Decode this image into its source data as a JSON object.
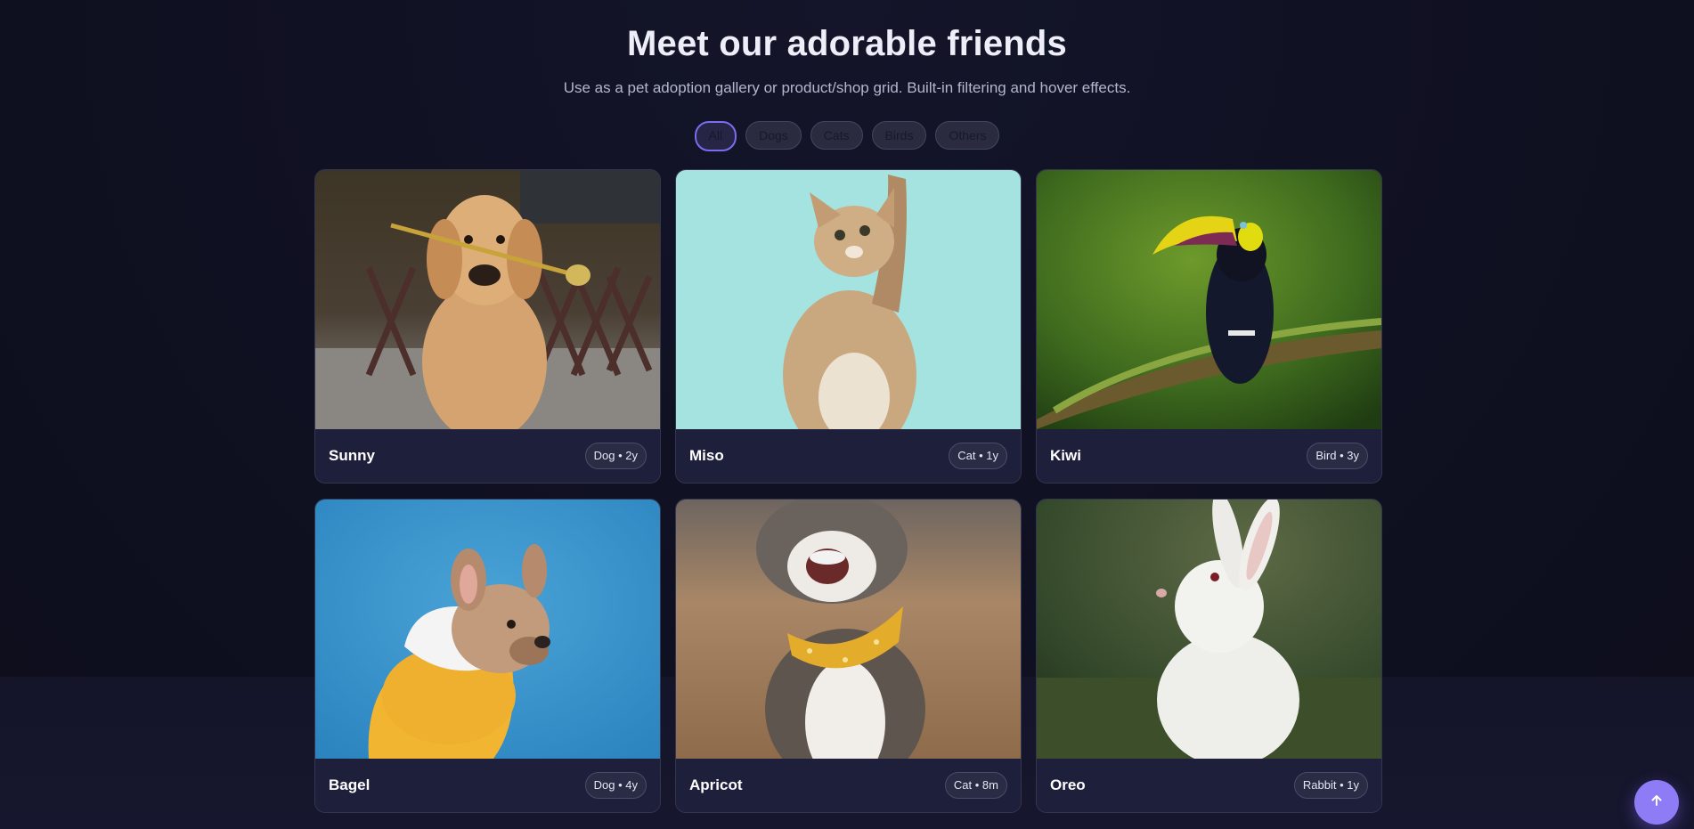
{
  "header": {
    "title": "Meet our adorable friends",
    "subtitle": "Use as a pet adoption gallery or product/shop grid. Built-in filtering and hover effects."
  },
  "filters": [
    {
      "label": "All",
      "active": true
    },
    {
      "label": "Dogs",
      "active": false
    },
    {
      "label": "Cats",
      "active": false
    },
    {
      "label": "Birds",
      "active": false
    },
    {
      "label": "Others",
      "active": false
    }
  ],
  "pets": [
    {
      "name": "Sunny",
      "badge": "Dog • 2y",
      "photo": "golden-retriever-photo"
    },
    {
      "name": "Miso",
      "badge": "Cat • 1y",
      "photo": "kitten-photo"
    },
    {
      "name": "Kiwi",
      "badge": "Bird • 3y",
      "photo": "toucan-photo"
    },
    {
      "name": "Bagel",
      "badge": "Dog • 4y",
      "photo": "french-bulldog-photo"
    },
    {
      "name": "Apricot",
      "badge": "Cat • 8m",
      "photo": "tabby-cat-photo"
    },
    {
      "name": "Oreo",
      "badge": "Rabbit • 1y",
      "photo": "white-rabbit-photo"
    }
  ],
  "scroll_top": {
    "icon": "arrow-up-icon"
  },
  "colors": {
    "accent": "#8e7cf7",
    "background": "#0f1021",
    "card": "#1e1f3a"
  }
}
